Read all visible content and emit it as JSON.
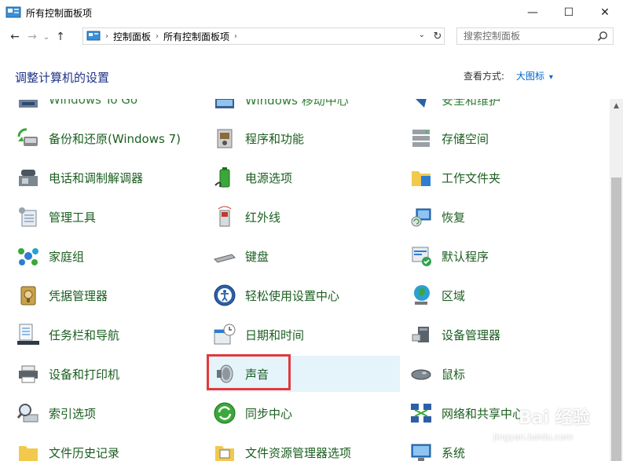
{
  "window": {
    "title": "所有控制面板项",
    "controls": {
      "minimize": "—",
      "maximize": "☐",
      "close": "✕"
    }
  },
  "nav": {
    "back": "←",
    "forward": "→",
    "dropdown": "⌄",
    "up": "↑",
    "breadcrumbs": [
      "控制面板",
      "所有控制面板项"
    ],
    "separator": "›",
    "address_dropdown": "⌄",
    "refresh": "↻",
    "search_placeholder": "搜索控制面板"
  },
  "header": {
    "title": "调整计算机的设置",
    "view_label": "查看方式:",
    "view_value": "大图标",
    "view_arrow": "▾"
  },
  "items": [
    {
      "label": "Windows To Go",
      "icon": "usb-drive-icon"
    },
    {
      "label": "Windows 移动中心",
      "icon": "mobility-center-icon"
    },
    {
      "label": "安全和维护",
      "icon": "security-flag-icon"
    },
    {
      "label": "备份和还原(Windows 7)",
      "icon": "backup-restore-icon"
    },
    {
      "label": "程序和功能",
      "icon": "programs-features-icon"
    },
    {
      "label": "存储空间",
      "icon": "storage-spaces-icon"
    },
    {
      "label": "电话和调制解调器",
      "icon": "phone-modem-icon"
    },
    {
      "label": "电源选项",
      "icon": "power-options-icon"
    },
    {
      "label": "工作文件夹",
      "icon": "work-folders-icon"
    },
    {
      "label": "管理工具",
      "icon": "admin-tools-icon"
    },
    {
      "label": "红外线",
      "icon": "infrared-icon"
    },
    {
      "label": "恢复",
      "icon": "recovery-icon"
    },
    {
      "label": "家庭组",
      "icon": "homegroup-icon"
    },
    {
      "label": "键盘",
      "icon": "keyboard-icon"
    },
    {
      "label": "默认程序",
      "icon": "default-programs-icon"
    },
    {
      "label": "凭据管理器",
      "icon": "credential-manager-icon"
    },
    {
      "label": "轻松使用设置中心",
      "icon": "ease-of-access-icon"
    },
    {
      "label": "区域",
      "icon": "region-globe-icon"
    },
    {
      "label": "任务栏和导航",
      "icon": "taskbar-navigation-icon"
    },
    {
      "label": "日期和时间",
      "icon": "date-time-icon"
    },
    {
      "label": "设备管理器",
      "icon": "device-manager-icon"
    },
    {
      "label": "设备和打印机",
      "icon": "devices-printers-icon"
    },
    {
      "label": "声音",
      "icon": "sound-speaker-icon"
    },
    {
      "label": "鼠标",
      "icon": "mouse-icon"
    },
    {
      "label": "索引选项",
      "icon": "indexing-options-icon"
    },
    {
      "label": "同步中心",
      "icon": "sync-center-icon"
    },
    {
      "label": "网络和共享中心",
      "icon": "network-sharing-icon"
    },
    {
      "label": "文件历史记录",
      "icon": "file-history-icon"
    },
    {
      "label": "文件资源管理器选项",
      "icon": "file-explorer-options-icon"
    },
    {
      "label": "系统",
      "icon": "system-icon"
    }
  ],
  "watermark": {
    "main": "Bai 经验",
    "sub": "jingyan.baidu.com"
  },
  "colors": {
    "link_green": "#1b5e20",
    "title_blue": "#1e3287",
    "hover_bg": "#e5f3fb",
    "highlight_red": "#e03a3a"
  }
}
